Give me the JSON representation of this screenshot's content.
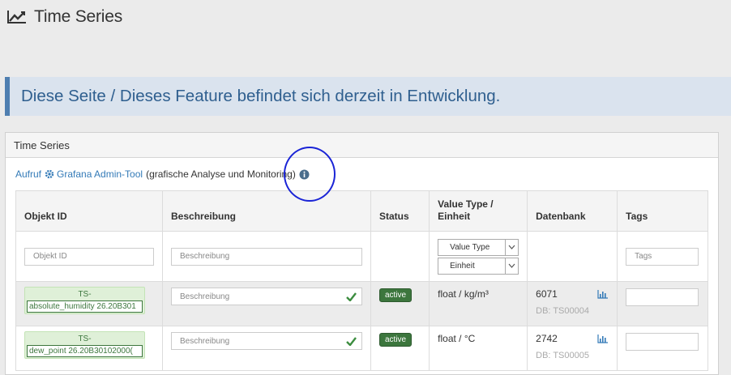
{
  "header": {
    "title": "Time Series",
    "icon": "line-chart-icon"
  },
  "banner": {
    "text": "Diese Seite / Dieses Feature befindet sich derzeit in Entwicklung."
  },
  "panel": {
    "title": "Time Series",
    "link_prefix": "Aufruf",
    "link_label": "Grafana Admin-Tool",
    "link_suffix": "(grafische Analyse und Monitoring)"
  },
  "table": {
    "columns": {
      "object_id": "Objekt ID",
      "description": "Beschreibung",
      "status": "Status",
      "value_type_line1": "Value Type /",
      "value_type_line2": "Einheit",
      "database": "Datenbank",
      "tags": "Tags"
    },
    "filters": {
      "object_id_placeholder": "Objekt ID",
      "description_placeholder": "Beschreibung",
      "value_type_selected": "Value Type",
      "unit_selected": "Einheit",
      "tags_placeholder": "Tags"
    },
    "rows": [
      {
        "id_prefix": "TS-",
        "id_value": "absolute_humidity 26.20B301",
        "description_placeholder": "Beschreibung",
        "status": "active",
        "value_type": "float / kg/m³",
        "db_count": "6071",
        "db_name": "DB: TS00004"
      },
      {
        "id_prefix": "TS-",
        "id_value": "dew_point 26.20B30102000(",
        "description_placeholder": "Beschreibung",
        "status": "active",
        "value_type": "float / °C",
        "db_count": "2742",
        "db_name": "DB: TS00005"
      }
    ]
  },
  "colors": {
    "accent": "#337ab7",
    "banner_bg": "#dae3ee",
    "banner_border": "#4f7fb0",
    "status_active": "#3c763d",
    "highlight_circle": "#1a24d6"
  }
}
